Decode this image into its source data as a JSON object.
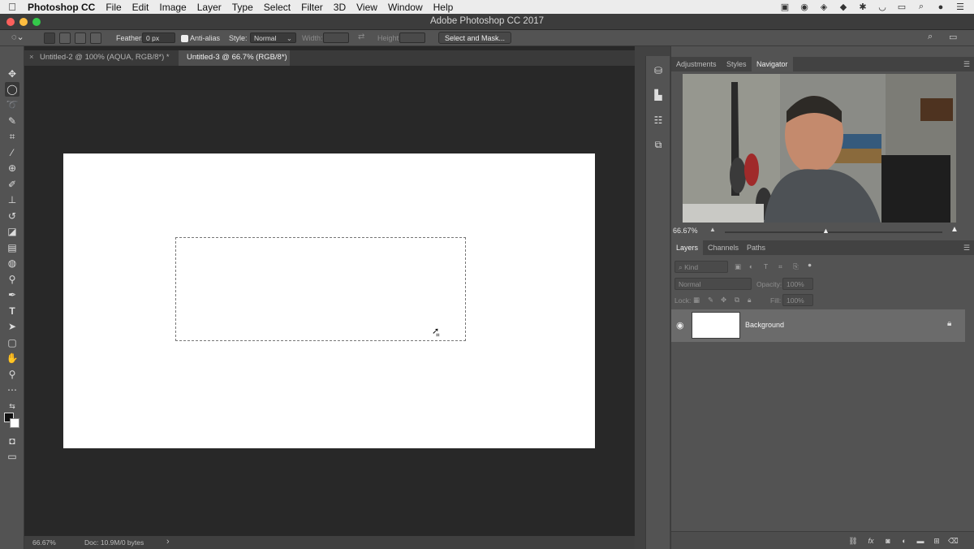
{
  "menubar": {
    "apple": "",
    "app_name": "Photoshop CC",
    "items": [
      "File",
      "Edit",
      "Image",
      "Layer",
      "Type",
      "Select",
      "Filter",
      "3D",
      "View",
      "Window",
      "Help"
    ]
  },
  "window": {
    "title": "Adobe Photoshop CC 2017"
  },
  "options": {
    "feather_label": "Feather:",
    "feather_value": "0 px",
    "antialias_label": "Anti-alias",
    "style_label": "Style:",
    "style_value": "Normal",
    "width_label": "Width:",
    "height_label": "Height:",
    "select_mask_label": "Select and Mask..."
  },
  "tabs": [
    {
      "label": "Untitled-2 @ 100% (AQUA, RGB/8*) *",
      "active": false
    },
    {
      "label": "Untitled-3 @ 66.7% (RGB/8*)",
      "active": true
    }
  ],
  "status": {
    "zoom": "66.67%",
    "doc": "Doc: 10.9M/0 bytes",
    "arrow": "›"
  },
  "panels": {
    "top_tabs": [
      "Adjustments",
      "Styles",
      "Navigator"
    ],
    "top_active": "Navigator",
    "navigator_zoom": "66.67%",
    "layer_tabs": [
      "Layers",
      "Channels",
      "Paths"
    ],
    "layer_active": "Layers",
    "kind_placeholder": "Kind",
    "blend_mode": "Normal",
    "opacity_label": "Opacity:",
    "opacity_value": "100%",
    "lock_label": "Lock:",
    "fill_label": "Fill:",
    "fill_value": "100%",
    "layers": [
      {
        "name": "Background",
        "visible": true,
        "locked": true
      }
    ]
  },
  "icons": {
    "apple": "apple-icon",
    "move_tool": "move-icon",
    "marquee_tool": "ellipse-marquee-icon",
    "navigator": "navigator-thumbnail"
  },
  "colors": {
    "app_bg": "#282828",
    "panel": "#535353",
    "tab_bar": "#3a3a3a",
    "traffic_red": "#fc605c",
    "traffic_yellow": "#fdbc40",
    "traffic_green": "#34c84a"
  }
}
